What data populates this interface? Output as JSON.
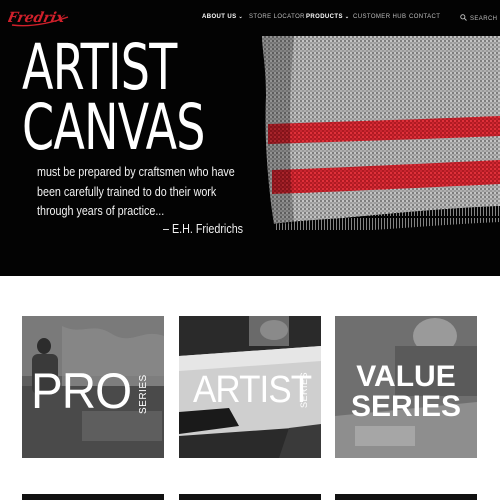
{
  "brand": {
    "logo_text": "Fredrix",
    "logo_color": "#d0202b"
  },
  "nav": {
    "items": [
      {
        "label": "ABOUT US",
        "has_dropdown": true
      },
      {
        "label": "STORE LOCATOR",
        "has_dropdown": false
      },
      {
        "label": "PRODUCTS",
        "has_dropdown": true
      },
      {
        "label": "CUSTOMER HUB",
        "has_dropdown": false
      },
      {
        "label": "CONTACT",
        "has_dropdown": false
      }
    ],
    "search_label": "SEARCH",
    "dropdown_glyph": "⌄"
  },
  "hero": {
    "headline_line1": "ARTIST",
    "headline_line2": "CANVAS",
    "quote_lines": [
      "must be prepared by craftsmen who have",
      "been carefully trained to do their work",
      "through years of practice..."
    ],
    "attribution": "– E.H. Friedrichs",
    "stripe_color": "#d3222a"
  },
  "tiles": [
    {
      "main": "PRO",
      "sub": "SERIES"
    },
    {
      "main": "ARTIST",
      "sub": "SERIES"
    },
    {
      "main": "VALUE SERIES",
      "sub": ""
    }
  ]
}
